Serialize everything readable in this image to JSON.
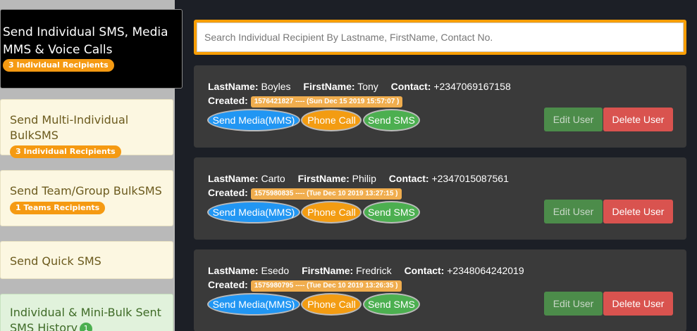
{
  "sidebar": {
    "active": {
      "line1": "Send Individual SMS, Media",
      "line2": "MMS & Voice Calls",
      "badge": "3 Individual Recipients"
    },
    "multi": {
      "line1": "Send Multi-Individual",
      "line2": "BulkSMS",
      "badge": "3 Individual Recipients"
    },
    "team": {
      "line1": "Send Team/Group BulkSMS",
      "badge": "1 Teams Recipients"
    },
    "quick": {
      "line1": "Send Quick SMS"
    },
    "history": {
      "line1": "Individual & Mini-Bulk Sent",
      "line2": "SMS History",
      "count": "1"
    }
  },
  "search": {
    "placeholder": "Search Individual Recipient By Lastname, FirstName, Contact No."
  },
  "labels": {
    "lastname": "LastName:",
    "firstname": "FirstName:",
    "contact": "Contact:",
    "created": "Created:",
    "media": "Send Media(MMS)",
    "call": "Phone Call",
    "sms": "Send SMS",
    "edit": "Edit User",
    "delete": "Delete User"
  },
  "users": [
    {
      "lastname": "Boyles",
      "firstname": "Tony",
      "contact": "+2347069167158",
      "created": "1576421827 ---- (Sun Dec 15 2019 15:57:07 )"
    },
    {
      "lastname": "Carto",
      "firstname": "Philip",
      "contact": "+2347015087561",
      "created": "1575980835 ---- (Tue Dec 10 2019 13:27:15 )"
    },
    {
      "lastname": "Esedo",
      "firstname": "Fredrick",
      "contact": "+2348064242019",
      "created": "1575980795 ---- (Tue Dec 10 2019 13:26:35 )"
    }
  ]
}
